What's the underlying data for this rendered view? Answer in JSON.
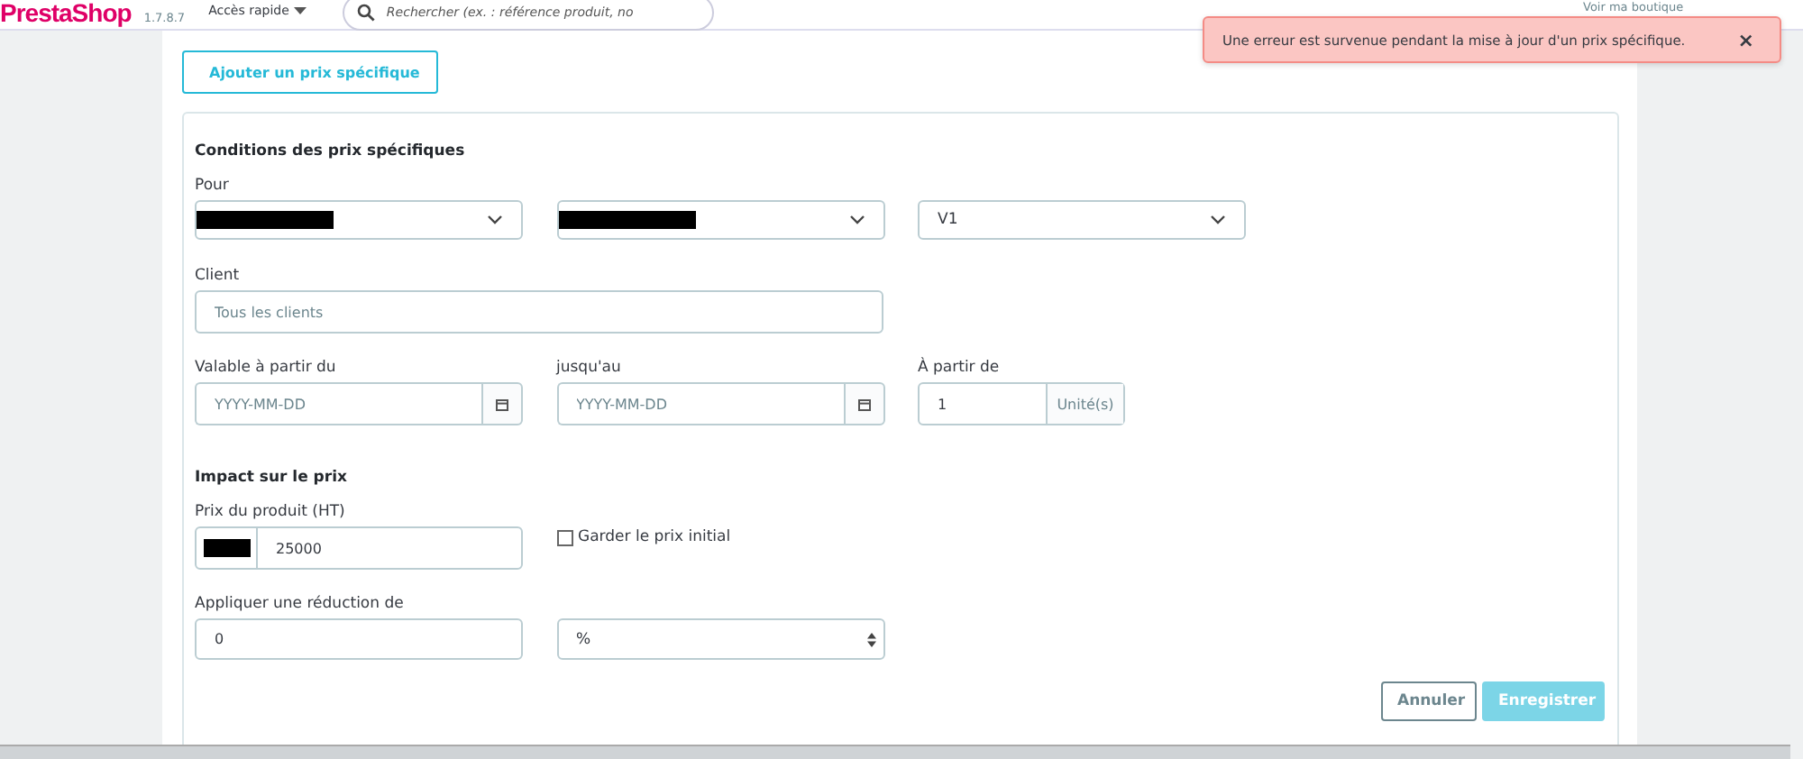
{
  "header": {
    "logo": "PrestaShop",
    "version": "1.7.8.7",
    "quick_access": "Accès rapide",
    "search": {
      "placeholder": "Rechercher (ex. : référence produit, no"
    },
    "shop_link": "Voir ma boutique"
  },
  "notification": {
    "message": "Une erreur est survenue pendant la mise à jour d'un prix spécifique.",
    "close": "×"
  },
  "add_button": "Ajouter un prix spécifique",
  "conditions": {
    "title": "Conditions des prix spécifiques",
    "for_label": "Pour",
    "selects": [
      {
        "kind": "redacted"
      },
      {
        "kind": "redacted"
      },
      {
        "kind": "text",
        "value": "V1"
      }
    ],
    "client_label": "Client",
    "client": {
      "placeholder": "Tous les clients"
    },
    "from_label": "Valable à partir du",
    "from": {
      "placeholder": "YYYY-MM-DD"
    },
    "to_label": "jusqu'au",
    "to": {
      "placeholder": "YYYY-MM-DD"
    },
    "qty_label": "À partir de",
    "qty": {
      "value": "1",
      "unit": "Unité(s)"
    }
  },
  "impact": {
    "title": "Impact sur le prix",
    "price_label": "Prix du produit (HT)",
    "price": "25000",
    "keep_initial": {
      "label": "Garder le prix initial",
      "checked": false
    },
    "reduction_label": "Appliquer une réduction de",
    "reduction": "0",
    "reduction_type": "%"
  },
  "buttons": [
    {
      "kind": "secondary",
      "label": "Annuler"
    },
    {
      "kind": "primary",
      "label": "Enregistrer"
    }
  ]
}
